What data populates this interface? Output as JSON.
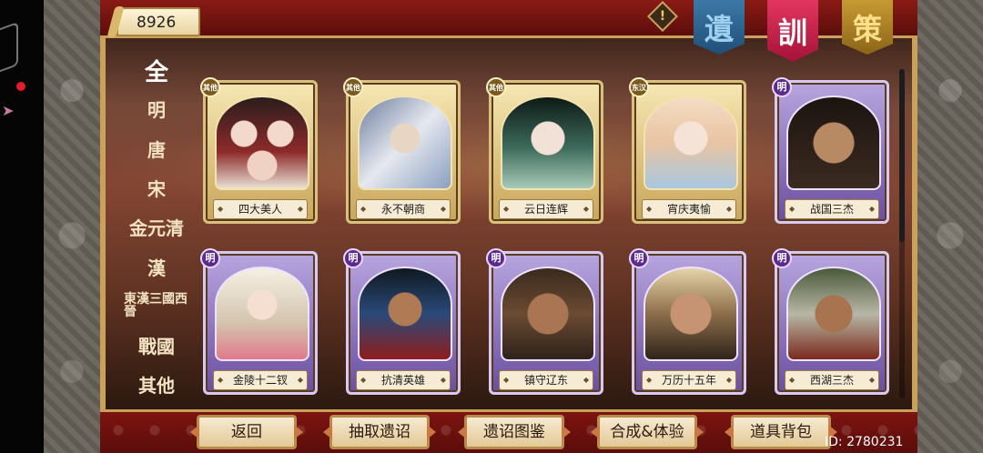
{
  "currency": {
    "value": "8926"
  },
  "banners": [
    {
      "label": "遺",
      "color": "#3c78a6"
    },
    {
      "label": "訓",
      "color": "#e2365f"
    },
    {
      "label": "策",
      "color": "#c79a34"
    }
  ],
  "warning": {
    "label": "!"
  },
  "categories": [
    {
      "label": "全"
    },
    {
      "label": "明"
    },
    {
      "label": "唐"
    },
    {
      "label": "宋"
    },
    {
      "label": "金元清"
    },
    {
      "label": "漢"
    },
    {
      "label": "東漢三國西晉"
    },
    {
      "label": "戰國"
    },
    {
      "label": "其他"
    }
  ],
  "cards": [
    {
      "name": "四大美人",
      "badge": "其他",
      "style": "gold"
    },
    {
      "name": "永不朝商",
      "badge": "其他",
      "style": "gold"
    },
    {
      "name": "云日连辉",
      "badge": "其他",
      "style": "gold"
    },
    {
      "name": "宵庆夷愉",
      "badge": "东汉",
      "style": "gold"
    },
    {
      "name": "战国三杰",
      "badge": "明",
      "style": "purple"
    },
    {
      "name": "金陵十二钗",
      "badge": "明",
      "style": "purple"
    },
    {
      "name": "抗清英雄",
      "badge": "明",
      "style": "purple"
    },
    {
      "name": "镇守辽东",
      "badge": "明",
      "style": "purple"
    },
    {
      "name": "万历十五年",
      "badge": "明",
      "style": "purple"
    },
    {
      "name": "西湖三杰",
      "badge": "明",
      "style": "purple"
    }
  ],
  "buttons": {
    "back": "返回",
    "draw": "抽取遗诏",
    "codex": "遗诏图鉴",
    "synthesize": "合成&体验",
    "bag": "道具背包"
  },
  "user_id": "ID: 2780231"
}
